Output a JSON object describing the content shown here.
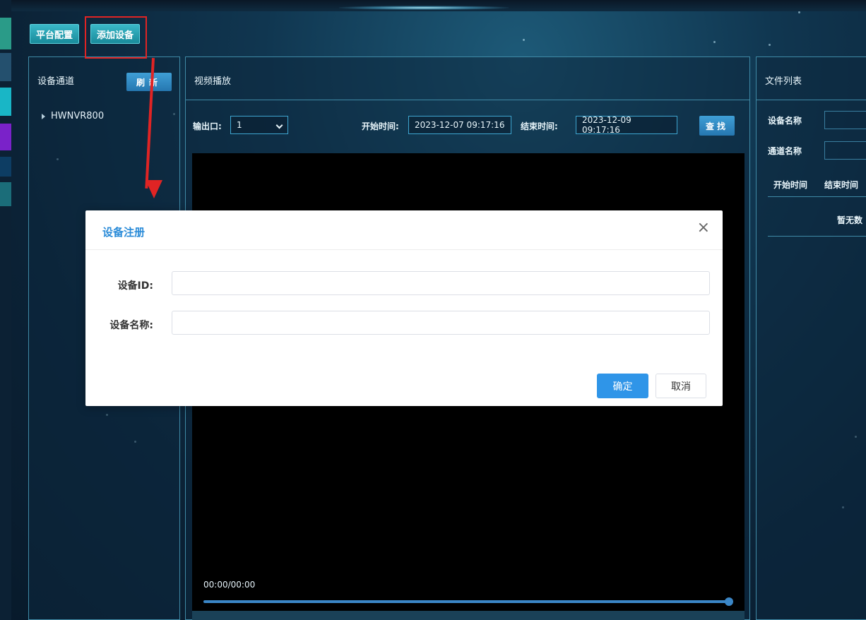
{
  "toolbar": {
    "platform_config": "平台配置",
    "add_device": "添加设备"
  },
  "left_panel": {
    "title": "设备通道",
    "refresh": "刷新",
    "tree_items": [
      "HWNVR800"
    ]
  },
  "video_panel": {
    "title": "视频播放",
    "output_label": "输出口:",
    "output_value": "1",
    "start_label": "开始时间:",
    "start_value": "2023-12-07 09:17:16",
    "end_label": "结束时间:",
    "end_value": "2023-12-09 09:17:16",
    "find": "查找",
    "time_display": "00:00/00:00",
    "progress": 1.0
  },
  "right_panel": {
    "title": "文件列表",
    "device_name_label": "设备名称",
    "channel_name_label": "通道名称",
    "col_start": "开始时间",
    "col_end": "结束时间",
    "empty": "暂无数"
  },
  "dialog": {
    "title": "设备注册",
    "close": "×",
    "device_id_label": "设备ID:",
    "device_id_value": "",
    "device_name_label": "设备名称:",
    "device_name_value": "",
    "ok": "确定",
    "cancel": "取消"
  },
  "colors": {
    "accent": "#2f95e8",
    "annotation": "#e02424",
    "panel_border": "#3f8aa6"
  }
}
